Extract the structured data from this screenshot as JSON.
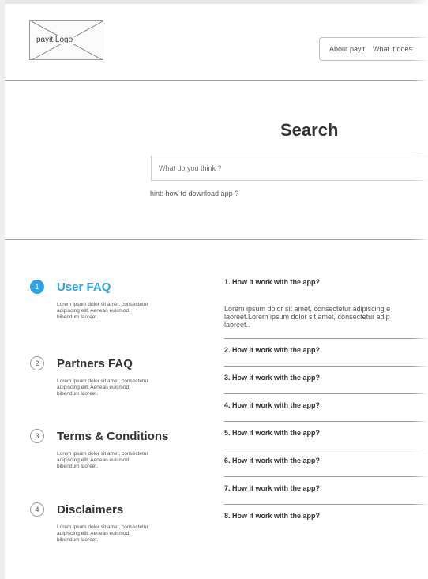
{
  "header": {
    "logo_text": "payit Logo",
    "nav_items": [
      "About payit",
      "What it does"
    ]
  },
  "search": {
    "title": "Search",
    "placeholder": "What do you think ?",
    "hint": "hint: how to download app ?"
  },
  "categories": [
    {
      "number": "1",
      "title": "User FAQ",
      "active": true,
      "desc": "Lorem ipsum dolor sit amet, consectetur adipiscing elit. Aenean euismod bibendum laoreet."
    },
    {
      "number": "2",
      "title": "Partners FAQ",
      "active": false,
      "desc": "Lorem ipsum dolor sit amet, consectetur adipiscing elit. Aenean euismod bibendum laoreet."
    },
    {
      "number": "3",
      "title": "Terms & Conditions",
      "active": false,
      "desc": "Lorem ipsum dolor sit amet, consectetur adipiscing elit. Aenean euismod bibendum laoreet."
    },
    {
      "number": "4",
      "title": "Disclaimers",
      "active": false,
      "desc": "Lorem ipsum dolor sit amet, consectetur adipiscing elit. Aenean euismod bibendum laoreet."
    }
  ],
  "questions": [
    {
      "label": "1. How it work with the app?"
    },
    {
      "label": "2. How it work with the app?"
    },
    {
      "label": "3. How it work with the app?"
    },
    {
      "label": "4. How it work with the app?"
    },
    {
      "label": "5. How it work with the app?"
    },
    {
      "label": "6. How it work with the app?"
    },
    {
      "label": "7. How it work with the app?"
    },
    {
      "label": "8. How it work with the app?"
    }
  ],
  "answer": {
    "line1": "Lorem ipsum dolor sit amet, consectetur adipiscing e",
    "line2": "laoreet.Lorem ipsum dolor sit amet, consectetur adip",
    "line3": "laoreet.."
  },
  "colors": {
    "accent": "#2ba3de",
    "divider": "#9c9c9c"
  }
}
